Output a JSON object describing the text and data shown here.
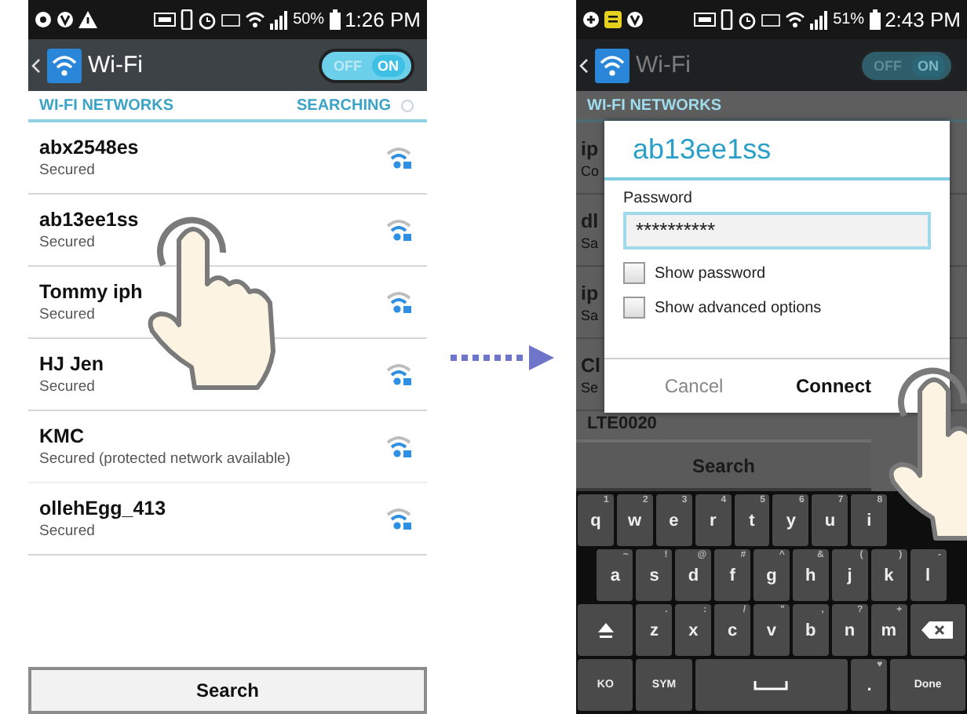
{
  "left_phone": {
    "status_bar": {
      "battery": "50%",
      "time": "1:26 PM"
    },
    "action_bar": {
      "title": "Wi-Fi",
      "toggle": {
        "off_label": "OFF",
        "on_label": "ON",
        "on": true
      }
    },
    "section": {
      "title": "WI-FI NETWORKS",
      "status": "SEARCHING"
    },
    "networks": [
      {
        "name": "abx2548es",
        "status": "Secured"
      },
      {
        "name": "ab13ee1ss",
        "status": "Secured"
      },
      {
        "name": "Tommy iph",
        "status": "Secured"
      },
      {
        "name": "HJ Jen",
        "status": "Secured"
      },
      {
        "name": "KMC",
        "status": "Secured (protected network available)"
      },
      {
        "name": "ollehEgg_413",
        "status": "Secured"
      }
    ],
    "search_button": "Search"
  },
  "right_phone": {
    "status_bar": {
      "battery": "51%",
      "time": "2:43 PM"
    },
    "action_bar": {
      "title": "Wi-Fi",
      "toggle": {
        "off_label": "OFF",
        "on_label": "ON",
        "on": true
      }
    },
    "section": {
      "title": "WI-FI NETWORKS"
    },
    "background_rows": [
      {
        "name": "ip",
        "status": "Co"
      },
      {
        "name": "dl",
        "status": "Sa"
      },
      {
        "name": "ip",
        "status": "Sa"
      },
      {
        "name": "Cl",
        "status": "Se"
      }
    ],
    "partial_row": "LTE0020",
    "dialog": {
      "title": "ab13ee1ss",
      "password_label": "Password",
      "password_value": "**********",
      "options": [
        {
          "label": "Show password",
          "checked": false
        },
        {
          "label": "Show advanced options",
          "checked": false
        }
      ],
      "buttons": [
        {
          "label": "Cancel",
          "kind": "cancel"
        },
        {
          "label": "Connect",
          "kind": "confirm"
        }
      ]
    },
    "search_bar": "Search",
    "keyboard": {
      "rows": [
        {
          "keys": [
            {
              "kind": "letter",
              "label": "q",
              "hint": "1"
            },
            {
              "kind": "letter",
              "label": "w",
              "hint": "2"
            },
            {
              "kind": "letter",
              "label": "e",
              "hint": "3"
            },
            {
              "kind": "letter",
              "label": "r",
              "hint": "4"
            },
            {
              "kind": "letter",
              "label": "t",
              "hint": "5"
            },
            {
              "kind": "letter",
              "label": "y",
              "hint": "6"
            },
            {
              "kind": "letter",
              "label": "u",
              "hint": "7"
            },
            {
              "kind": "letter",
              "label": "i",
              "hint": "8"
            }
          ]
        },
        {
          "keys": [
            {
              "kind": "letter",
              "label": "a",
              "hint": "~"
            },
            {
              "kind": "letter",
              "label": "s",
              "hint": "!"
            },
            {
              "kind": "letter",
              "label": "d",
              "hint": "@"
            },
            {
              "kind": "letter",
              "label": "f",
              "hint": "#"
            },
            {
              "kind": "letter",
              "label": "g",
              "hint": "^"
            },
            {
              "kind": "letter",
              "label": "h",
              "hint": "&"
            },
            {
              "kind": "letter",
              "label": "j",
              "hint": "("
            },
            {
              "kind": "letter",
              "label": "k",
              "hint": ")"
            },
            {
              "kind": "letter",
              "label": "l",
              "hint": "-"
            }
          ]
        },
        {
          "keys": [
            {
              "kind": "shift"
            },
            {
              "kind": "letter",
              "label": "z",
              "hint": "."
            },
            {
              "kind": "letter",
              "label": "x",
              "hint": ":"
            },
            {
              "kind": "letter",
              "label": "c",
              "hint": "/"
            },
            {
              "kind": "letter",
              "label": "v",
              "hint": "\""
            },
            {
              "kind": "letter",
              "label": "b",
              "hint": ","
            },
            {
              "kind": "letter",
              "label": "n",
              "hint": "?"
            },
            {
              "kind": "letter",
              "label": "m",
              "hint": "+"
            },
            {
              "kind": "backspace"
            }
          ]
        },
        {
          "keys": [
            {
              "kind": "label",
              "label": "KO"
            },
            {
              "kind": "label",
              "label": "SYM"
            },
            {
              "kind": "space"
            },
            {
              "kind": "letter",
              "label": ".",
              "hint": "♥"
            },
            {
              "kind": "done",
              "label": "Done"
            }
          ]
        }
      ]
    }
  }
}
